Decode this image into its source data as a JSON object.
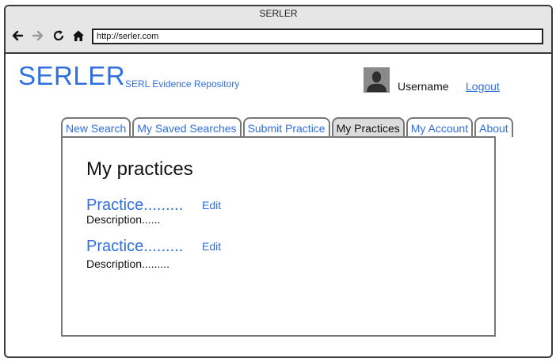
{
  "window": {
    "title": "SERLER"
  },
  "browser": {
    "url": "http://serler.com",
    "icons": [
      "back-arrow-icon",
      "forward-arrow-icon",
      "reload-icon",
      "home-icon"
    ]
  },
  "header": {
    "brand": "SERLER",
    "subtitle": "SERL Evidence Repository",
    "username": "Username",
    "logout": "Logout"
  },
  "tabs": [
    {
      "label": "New Search",
      "active": false
    },
    {
      "label": "My Saved Searches",
      "active": false
    },
    {
      "label": "Submit Practice",
      "active": false
    },
    {
      "label": "My Practices",
      "active": true
    },
    {
      "label": "My Account",
      "active": false
    },
    {
      "label": "About",
      "active": false
    }
  ],
  "main": {
    "heading": "My practices",
    "practices": [
      {
        "title": "Practice.........",
        "edit": "Edit",
        "description": "Description......"
      },
      {
        "title": "Practice.........",
        "edit": "Edit",
        "description": "Description........."
      }
    ]
  },
  "colors": {
    "accent": "#2f6fe0",
    "chrome": "#e6e6e6",
    "active_tab": "#dcdcdc"
  }
}
